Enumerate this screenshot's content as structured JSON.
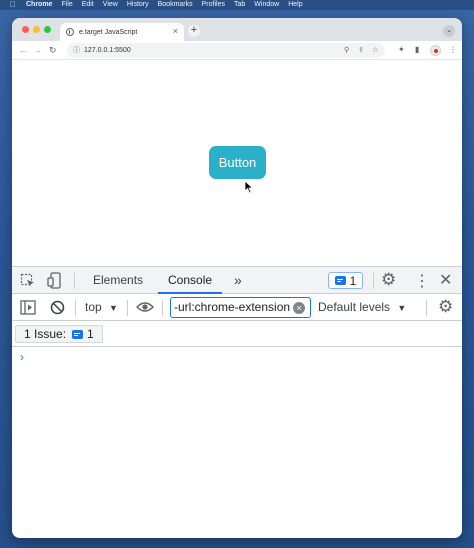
{
  "menubar": {
    "app": "Chrome",
    "items": [
      "File",
      "Edit",
      "View",
      "History",
      "Bookmarks",
      "Profiles",
      "Tab",
      "Window",
      "Help"
    ]
  },
  "browser": {
    "tab_title": "e.target JavaScript",
    "url": "127.0.0.1:5500"
  },
  "page": {
    "button_label": "Button"
  },
  "devtools": {
    "tabs": [
      "Elements",
      "Console"
    ],
    "active_tab": "Console",
    "more_tabs_label": "»",
    "issues_badge_count": "1",
    "context": "top",
    "filter_value": "-url:chrome-extension",
    "levels_label": "Default levels",
    "issues_chip_label": "1 Issue:",
    "issues_chip_count": "1",
    "prompt_symbol": "›"
  },
  "colors": {
    "accent": "#1a73e8",
    "button": "#2ab0c8"
  }
}
